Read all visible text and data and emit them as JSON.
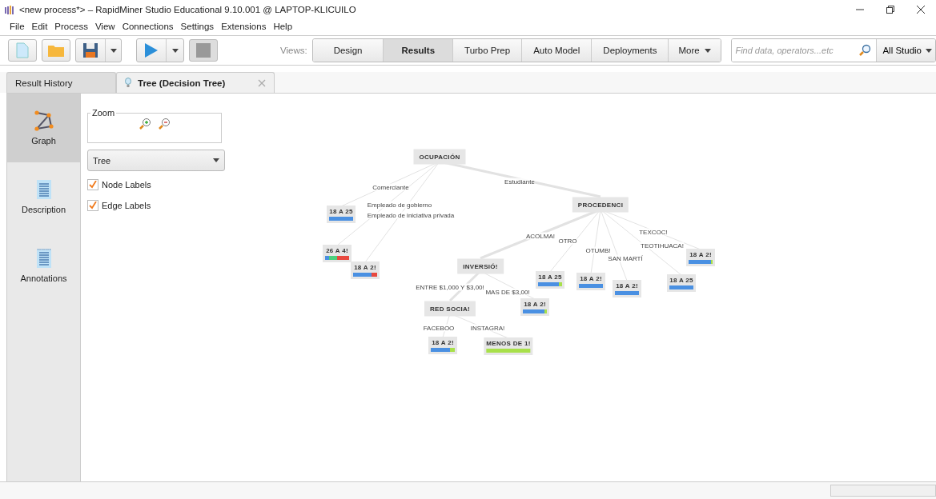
{
  "window": {
    "title": "<new process*> – RapidMiner Studio Educational 9.10.001 @ LAPTOP-KLICUILO"
  },
  "menu": [
    "File",
    "Edit",
    "Process",
    "View",
    "Connections",
    "Settings",
    "Extensions",
    "Help"
  ],
  "views_label": "Views:",
  "views": [
    {
      "label": "Design",
      "selected": false
    },
    {
      "label": "Results",
      "selected": true
    },
    {
      "label": "Turbo Prep",
      "selected": false
    },
    {
      "label": "Auto Model",
      "selected": false
    },
    {
      "label": "Deployments",
      "selected": false
    },
    {
      "label": "More",
      "selected": false
    }
  ],
  "search": {
    "placeholder": "Find data, operators...etc",
    "scope": "All Studio"
  },
  "tabs": [
    {
      "label": "Result History",
      "selected": false,
      "closable": false
    },
    {
      "label": "Tree (Decision Tree)",
      "selected": true,
      "closable": true
    }
  ],
  "side_nav": [
    {
      "label": "Graph",
      "kind": "graph",
      "selected": true
    },
    {
      "label": "Description",
      "kind": "document",
      "selected": false
    },
    {
      "label": "Annotations",
      "kind": "notes",
      "selected": false
    }
  ],
  "zoom": {
    "title": "Zoom"
  },
  "layout_select": {
    "value": "Tree"
  },
  "options": [
    {
      "label": "Node Labels",
      "checked": true
    },
    {
      "label": "Edge Labels",
      "checked": true
    }
  ],
  "tree": {
    "label": "OCUPACIÓN",
    "children": [
      {
        "edge": "Comerciante",
        "label": "18 A 25",
        "segments": [
          {
            "color": "#4a90e2",
            "level": 1
          }
        ]
      },
      {
        "edge": "Empleado de gobierno",
        "label": "26 A 4!",
        "segments": [
          {
            "color": "#4a90e2",
            "level": 0.15
          },
          {
            "color": "#4cd07d",
            "level": 0.35
          },
          {
            "color": "#e8493f",
            "level": 0.5
          }
        ]
      },
      {
        "edge": "Empleado de iniciativa privada",
        "label": "18 A 2!",
        "segments": [
          {
            "color": "#4a90e2",
            "level": 0.75
          },
          {
            "color": "#e8493f",
            "level": 0.25
          }
        ]
      },
      {
        "edge": "Estudiante",
        "label": "PROCEDENCI",
        "children": [
          {
            "edge": "ACOLMA!",
            "label": "INVERSIÓ!",
            "children": [
              {
                "edge": "ENTRE $1,000 Y $3,00!",
                "label": "RED SOCIA!",
                "children": [
                  {
                    "edge": "FACEBOO",
                    "label": "18 A 2!",
                    "segments": [
                      {
                        "color": "#4a90e2",
                        "level": 0.8
                      },
                      {
                        "color": "#a8e04a",
                        "level": 0.2
                      }
                    ]
                  },
                  {
                    "edge": "INSTAGRA!",
                    "label": "MENOS DE 1!",
                    "segments": [
                      {
                        "color": "#a8e04a",
                        "level": 1
                      }
                    ]
                  }
                ]
              },
              {
                "edge": "MAS DE $3,00!",
                "label": "18 A 2!",
                "segments": [
                  {
                    "color": "#4a90e2",
                    "level": 0.9
                  },
                  {
                    "color": "#a8e04a",
                    "level": 0.1
                  }
                ]
              }
            ]
          },
          {
            "edge": "OTRO",
            "label": "18 A 25",
            "segments": [
              {
                "color": "#4a90e2",
                "level": 0.85
              },
              {
                "color": "#a8e04a",
                "level": 0.15
              }
            ]
          },
          {
            "edge": "OTUMB!",
            "label": "18 A 2!",
            "segments": [
              {
                "color": "#4a90e2",
                "level": 1
              }
            ]
          },
          {
            "edge": "SAN MARTÍ",
            "label": "18 A 2!",
            "segments": [
              {
                "color": "#4a90e2",
                "level": 1
              }
            ]
          },
          {
            "edge": "TEOTIHUACA!",
            "label": "18 A 25",
            "segments": [
              {
                "color": "#4a90e2",
                "level": 1
              }
            ]
          },
          {
            "edge": "TEXCOC!",
            "label": "18 A 2!",
            "segments": [
              {
                "color": "#4a90e2",
                "level": 0.92
              },
              {
                "color": "#a8e04a",
                "level": 0.08
              }
            ]
          }
        ]
      }
    ]
  }
}
